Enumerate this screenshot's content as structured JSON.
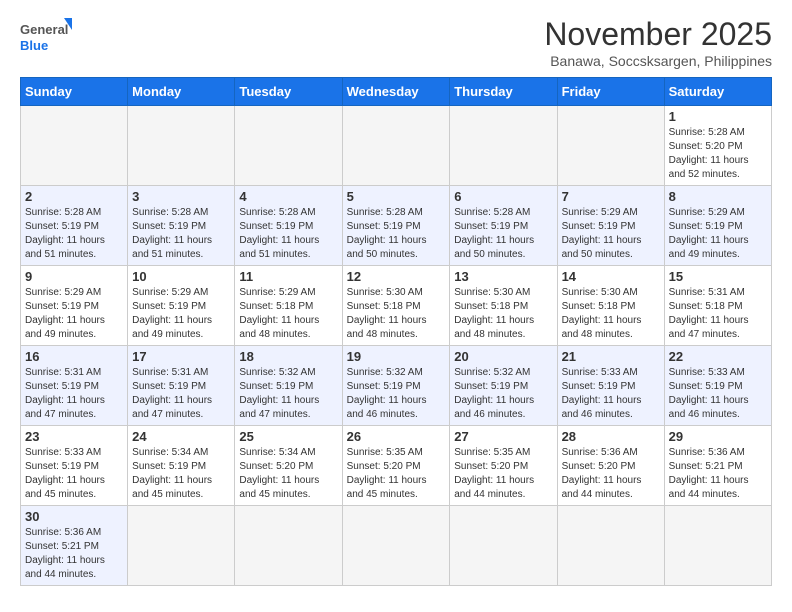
{
  "header": {
    "logo_general": "General",
    "logo_blue": "Blue",
    "month_title": "November 2025",
    "location": "Banawa, Soccsksargen, Philippines"
  },
  "days_of_week": [
    "Sunday",
    "Monday",
    "Tuesday",
    "Wednesday",
    "Thursday",
    "Friday",
    "Saturday"
  ],
  "weeks": [
    [
      {
        "day": "",
        "empty": true
      },
      {
        "day": "",
        "empty": true
      },
      {
        "day": "",
        "empty": true
      },
      {
        "day": "",
        "empty": true
      },
      {
        "day": "",
        "empty": true
      },
      {
        "day": "",
        "empty": true
      },
      {
        "day": "1",
        "sunrise": "Sunrise: 5:28 AM",
        "sunset": "Sunset: 5:20 PM",
        "daylight": "Daylight: 11 hours and 52 minutes."
      }
    ],
    [
      {
        "day": "2",
        "sunrise": "Sunrise: 5:28 AM",
        "sunset": "Sunset: 5:19 PM",
        "daylight": "Daylight: 11 hours and 51 minutes."
      },
      {
        "day": "3",
        "sunrise": "Sunrise: 5:28 AM",
        "sunset": "Sunset: 5:19 PM",
        "daylight": "Daylight: 11 hours and 51 minutes."
      },
      {
        "day": "4",
        "sunrise": "Sunrise: 5:28 AM",
        "sunset": "Sunset: 5:19 PM",
        "daylight": "Daylight: 11 hours and 51 minutes."
      },
      {
        "day": "5",
        "sunrise": "Sunrise: 5:28 AM",
        "sunset": "Sunset: 5:19 PM",
        "daylight": "Daylight: 11 hours and 50 minutes."
      },
      {
        "day": "6",
        "sunrise": "Sunrise: 5:28 AM",
        "sunset": "Sunset: 5:19 PM",
        "daylight": "Daylight: 11 hours and 50 minutes."
      },
      {
        "day": "7",
        "sunrise": "Sunrise: 5:29 AM",
        "sunset": "Sunset: 5:19 PM",
        "daylight": "Daylight: 11 hours and 50 minutes."
      },
      {
        "day": "8",
        "sunrise": "Sunrise: 5:29 AM",
        "sunset": "Sunset: 5:19 PM",
        "daylight": "Daylight: 11 hours and 49 minutes."
      }
    ],
    [
      {
        "day": "9",
        "sunrise": "Sunrise: 5:29 AM",
        "sunset": "Sunset: 5:19 PM",
        "daylight": "Daylight: 11 hours and 49 minutes."
      },
      {
        "day": "10",
        "sunrise": "Sunrise: 5:29 AM",
        "sunset": "Sunset: 5:19 PM",
        "daylight": "Daylight: 11 hours and 49 minutes."
      },
      {
        "day": "11",
        "sunrise": "Sunrise: 5:29 AM",
        "sunset": "Sunset: 5:18 PM",
        "daylight": "Daylight: 11 hours and 48 minutes."
      },
      {
        "day": "12",
        "sunrise": "Sunrise: 5:30 AM",
        "sunset": "Sunset: 5:18 PM",
        "daylight": "Daylight: 11 hours and 48 minutes."
      },
      {
        "day": "13",
        "sunrise": "Sunrise: 5:30 AM",
        "sunset": "Sunset: 5:18 PM",
        "daylight": "Daylight: 11 hours and 48 minutes."
      },
      {
        "day": "14",
        "sunrise": "Sunrise: 5:30 AM",
        "sunset": "Sunset: 5:18 PM",
        "daylight": "Daylight: 11 hours and 48 minutes."
      },
      {
        "day": "15",
        "sunrise": "Sunrise: 5:31 AM",
        "sunset": "Sunset: 5:18 PM",
        "daylight": "Daylight: 11 hours and 47 minutes."
      }
    ],
    [
      {
        "day": "16",
        "sunrise": "Sunrise: 5:31 AM",
        "sunset": "Sunset: 5:19 PM",
        "daylight": "Daylight: 11 hours and 47 minutes."
      },
      {
        "day": "17",
        "sunrise": "Sunrise: 5:31 AM",
        "sunset": "Sunset: 5:19 PM",
        "daylight": "Daylight: 11 hours and 47 minutes."
      },
      {
        "day": "18",
        "sunrise": "Sunrise: 5:32 AM",
        "sunset": "Sunset: 5:19 PM",
        "daylight": "Daylight: 11 hours and 47 minutes."
      },
      {
        "day": "19",
        "sunrise": "Sunrise: 5:32 AM",
        "sunset": "Sunset: 5:19 PM",
        "daylight": "Daylight: 11 hours and 46 minutes."
      },
      {
        "day": "20",
        "sunrise": "Sunrise: 5:32 AM",
        "sunset": "Sunset: 5:19 PM",
        "daylight": "Daylight: 11 hours and 46 minutes."
      },
      {
        "day": "21",
        "sunrise": "Sunrise: 5:33 AM",
        "sunset": "Sunset: 5:19 PM",
        "daylight": "Daylight: 11 hours and 46 minutes."
      },
      {
        "day": "22",
        "sunrise": "Sunrise: 5:33 AM",
        "sunset": "Sunset: 5:19 PM",
        "daylight": "Daylight: 11 hours and 46 minutes."
      }
    ],
    [
      {
        "day": "23",
        "sunrise": "Sunrise: 5:33 AM",
        "sunset": "Sunset: 5:19 PM",
        "daylight": "Daylight: 11 hours and 45 minutes."
      },
      {
        "day": "24",
        "sunrise": "Sunrise: 5:34 AM",
        "sunset": "Sunset: 5:19 PM",
        "daylight": "Daylight: 11 hours and 45 minutes."
      },
      {
        "day": "25",
        "sunrise": "Sunrise: 5:34 AM",
        "sunset": "Sunset: 5:20 PM",
        "daylight": "Daylight: 11 hours and 45 minutes."
      },
      {
        "day": "26",
        "sunrise": "Sunrise: 5:35 AM",
        "sunset": "Sunset: 5:20 PM",
        "daylight": "Daylight: 11 hours and 45 minutes."
      },
      {
        "day": "27",
        "sunrise": "Sunrise: 5:35 AM",
        "sunset": "Sunset: 5:20 PM",
        "daylight": "Daylight: 11 hours and 44 minutes."
      },
      {
        "day": "28",
        "sunrise": "Sunrise: 5:36 AM",
        "sunset": "Sunset: 5:20 PM",
        "daylight": "Daylight: 11 hours and 44 minutes."
      },
      {
        "day": "29",
        "sunrise": "Sunrise: 5:36 AM",
        "sunset": "Sunset: 5:21 PM",
        "daylight": "Daylight: 11 hours and 44 minutes."
      }
    ],
    [
      {
        "day": "30",
        "sunrise": "Sunrise: 5:36 AM",
        "sunset": "Sunset: 5:21 PM",
        "daylight": "Daylight: 11 hours and 44 minutes."
      },
      {
        "day": "",
        "empty": true
      },
      {
        "day": "",
        "empty": true
      },
      {
        "day": "",
        "empty": true
      },
      {
        "day": "",
        "empty": true
      },
      {
        "day": "",
        "empty": true
      },
      {
        "day": "",
        "empty": true
      }
    ]
  ]
}
